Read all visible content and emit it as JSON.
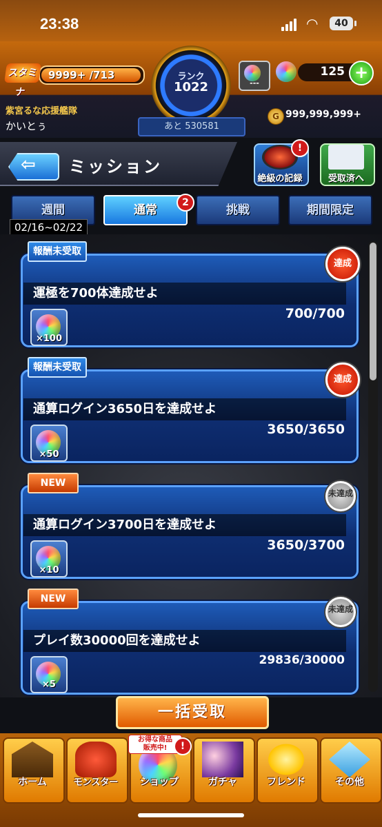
{
  "status_bar": {
    "time": "23:38",
    "battery": "40"
  },
  "hud": {
    "stamina_label": "スタミナ",
    "stamina_value": "9999+ /713",
    "rank_label": "ランク",
    "rank_value": "1022",
    "rank_next": "あと 530581",
    "slot_value": "---",
    "orb_count": "125",
    "team_name": "紫宮るな応援艦隊",
    "user_name": "かいとぅ",
    "gold": "999,999,999+"
  },
  "title_bar": {
    "title": "ミッション",
    "record_button": "絶級の記録",
    "received_button": "受取済へ",
    "record_badge": "!"
  },
  "tabs": [
    {
      "label": "週間"
    },
    {
      "label": "通常",
      "badge": "2"
    },
    {
      "label": "挑戦"
    },
    {
      "label": "期間限定"
    }
  ],
  "date_range": "02/16~02/22",
  "missions": [
    {
      "tag": "報酬未受取",
      "title": "運極を700体達成せよ",
      "progress": "700/700",
      "reward_qty": "×100",
      "stamp": "達成"
    },
    {
      "tag": "報酬未受取",
      "title": "通算ログイン3650日を達成せよ",
      "progress": "3650/3650",
      "reward_qty": "×50",
      "stamp": "達成"
    },
    {
      "tag": "NEW",
      "title": "通算ログイン3700日を達成せよ",
      "progress": "3650/3700",
      "reward_qty": "×10",
      "stamp": "未達成"
    },
    {
      "tag": "NEW",
      "title": "プレイ数30000回を達成せよ",
      "progress": "29836/30000",
      "reward_qty": "×5",
      "stamp": "未達成"
    }
  ],
  "collect_all": "一括受取",
  "nav": {
    "items": [
      {
        "label": "ホーム"
      },
      {
        "label": "モンスター"
      },
      {
        "label": "ショップ"
      },
      {
        "label": "ガチャ"
      },
      {
        "label": "フレンド"
      },
      {
        "label": "その他"
      }
    ],
    "shop_sale": "お得な商品\n販売中!",
    "shop_badge": "!"
  }
}
